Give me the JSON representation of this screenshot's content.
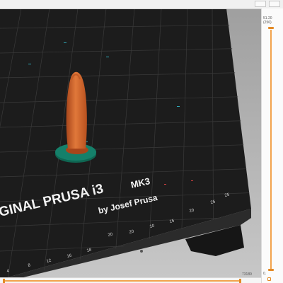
{
  "bed": {
    "logo_line1": "GINAL PRUSA i3",
    "logo_model": "MK3",
    "logo_line2": "by Josef Prusa",
    "ruler_bottom": [
      "4",
      "8",
      "12",
      "16",
      "18",
      "20"
    ],
    "ruler_side": [
      "10",
      "15",
      "20",
      "25"
    ],
    "grid_numbers_row": [
      "14",
      "16",
      "18",
      "20",
      "22",
      "24",
      "25"
    ]
  },
  "layer_slider": {
    "top_value": "51.20",
    "top_layer": "(256)",
    "bottom_value": "0."
  },
  "horizontal_slider": {
    "right_value": "73189"
  },
  "colors": {
    "accent": "#e38a26",
    "object": "#d4652a",
    "pad": "#15806a",
    "bed": "#1f1f1f"
  }
}
